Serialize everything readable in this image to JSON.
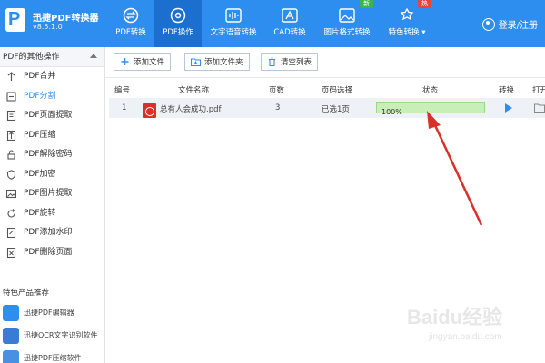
{
  "app": {
    "name": "迅捷PDF转换器",
    "version": "v8.5.1.0",
    "accent": "#2d8ef0"
  },
  "nav": {
    "items": [
      {
        "label": "PDF转换",
        "icon": "swap-icon"
      },
      {
        "label": "PDF操作",
        "icon": "settings-icon"
      },
      {
        "label": "文字语音转换",
        "icon": "waveform-icon"
      },
      {
        "label": "CAD转换",
        "icon": "cad-icon"
      },
      {
        "label": "图片格式转换",
        "icon": "image-icon",
        "badge": "新"
      },
      {
        "label": "特色转换 ▾",
        "icon": "gear-star-icon",
        "badge": "热"
      }
    ],
    "login": "登录/注册"
  },
  "sidebar": {
    "header": "PDF的其他操作",
    "items": [
      {
        "label": "PDF合并",
        "icon": "merge-icon"
      },
      {
        "label": "PDF分割",
        "icon": "split-icon"
      },
      {
        "label": "PDF页面提取",
        "icon": "page-extract-icon"
      },
      {
        "label": "PDF压缩",
        "icon": "compress-icon"
      },
      {
        "label": "PDF解除密码",
        "icon": "unlock-icon"
      },
      {
        "label": "PDF加密",
        "icon": "shield-icon"
      },
      {
        "label": "PDF图片提取",
        "icon": "image-extract-icon"
      },
      {
        "label": "PDF旋转",
        "icon": "rotate-icon"
      },
      {
        "label": "PDF添加水印",
        "icon": "watermark-icon"
      },
      {
        "label": "PDF删除页面",
        "icon": "delete-page-icon"
      }
    ],
    "promo_title": "特色产品推荐",
    "promos": [
      {
        "label": "迅捷PDF编辑器",
        "icon": "pdf-editor-icon"
      },
      {
        "label": "迅捷OCR文字识别软件",
        "icon": "ocr-icon"
      },
      {
        "label": "迅捷PDF压缩软件",
        "icon": "pdf-compress-icon"
      }
    ]
  },
  "toolbar": {
    "add_file": "添加文件",
    "add_folder": "添加文件夹",
    "clear_list": "清空列表"
  },
  "table": {
    "headers": [
      "编号",
      "文件名称",
      "页数",
      "页码选择",
      "状态",
      "转换",
      "打开"
    ],
    "rows": [
      {
        "index": "1",
        "filename": "总有人会成功.pdf",
        "pages": "3",
        "page_select": "已选1页",
        "status": "100%",
        "progress": 1.0
      }
    ]
  },
  "watermark": {
    "text": "Baidu经验",
    "sub": "jingyan.baidu.com"
  }
}
